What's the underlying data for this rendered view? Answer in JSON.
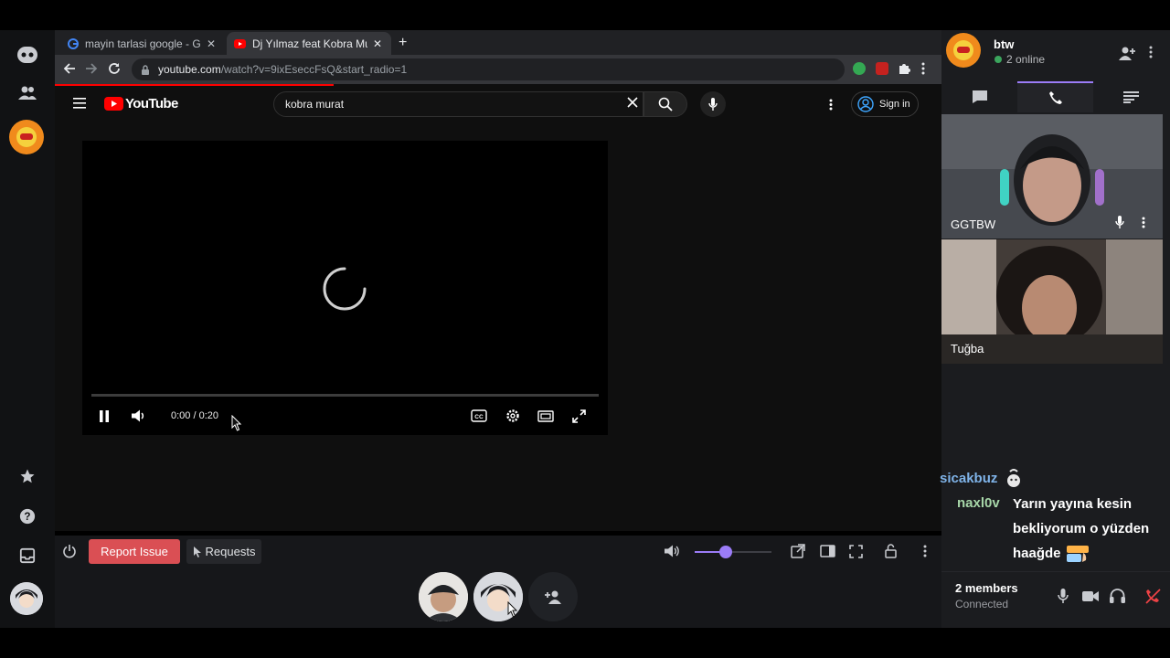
{
  "browser": {
    "tabs": [
      {
        "title": "mayin tarlasi google - Go",
        "icon": "google-icon",
        "active": false
      },
      {
        "title": "Dj Yılmaz feat Kobra Mur",
        "icon": "youtube-icon",
        "active": true
      }
    ],
    "address": {
      "host": "youtube.com",
      "rest": "/watch?v=9ixEseccFsQ&start_radio=1"
    }
  },
  "youtube": {
    "logo_text": "YouTube",
    "search_value": "kobra murat",
    "sign_in": "Sign in",
    "player": {
      "time": "0:00 / 0:20",
      "progress_fraction": 0
    }
  },
  "hyperbeam": {
    "report_label": "Report Issue",
    "requests_label": "Requests",
    "volume_fraction": 0.4
  },
  "room": {
    "name": "btw",
    "online": "2 online",
    "participants": [
      {
        "name": "GGTBW"
      },
      {
        "name": "Tuğba"
      }
    ],
    "chat": [
      {
        "user": "sicakbuz",
        "text": ""
      },
      {
        "user": "naxl0v",
        "text": "Yarın yayına kesin bekliyorum o yüzden haağde"
      }
    ],
    "footer": {
      "members": "2 members",
      "status": "Connected"
    }
  },
  "colors": {
    "accent": "#9b7cf7",
    "report": "#da4f54",
    "online": "#3ba55d",
    "youtube_red": "#ff0000"
  }
}
